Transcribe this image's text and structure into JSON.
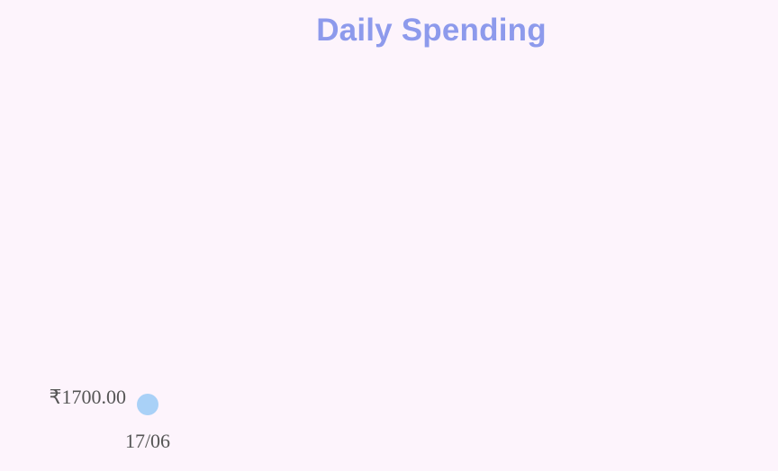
{
  "chart_data": {
    "type": "scatter",
    "title": "Daily Spending",
    "xlabel": "",
    "ylabel": "",
    "grid": false,
    "legend": "none",
    "x": [
      "17/06"
    ],
    "y_tick_labels": [
      "₹1700.00"
    ],
    "series": [
      {
        "values": [
          1700
        ],
        "color": "#a9d1f7"
      }
    ]
  },
  "colors": {
    "background": "#fdf4fc",
    "title": "#8d9aec",
    "point": "#a9d1f7",
    "tick_text": "#555555"
  }
}
